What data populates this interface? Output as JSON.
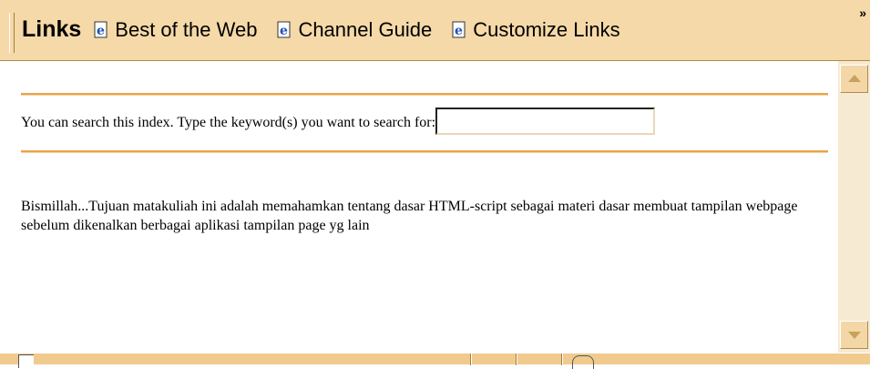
{
  "links_toolbar": {
    "title": "Links",
    "items": [
      {
        "label": "Best of the Web",
        "icon": "ie-page-icon"
      },
      {
        "label": "Channel Guide",
        "icon": "ie-page-icon"
      },
      {
        "label": "Customize Links",
        "icon": "ie-page-icon"
      }
    ],
    "overflow_label": "»"
  },
  "content": {
    "search_prompt": "You can search this index. Type the keyword(s) you want to search for:",
    "search_value": "",
    "description": "Bismillah...Tujuan matakuliah ini adalah memahamkan tentang dasar HTML-script sebagai materi dasar membuat tampilan webpage sebelum dikenalkan berbagai aplikasi tampilan page yg lain"
  },
  "colors": {
    "toolbar_bg": "#f5d9a8",
    "rule_color": "#e7a44a",
    "scrollbar_track": "#f7ead3"
  }
}
